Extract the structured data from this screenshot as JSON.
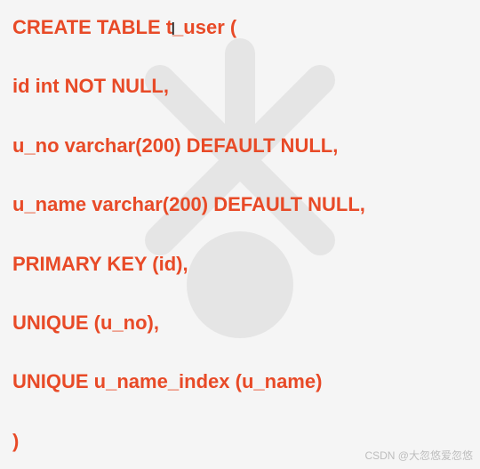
{
  "sql": {
    "lines": [
      "CREATE TABLE t_user (",
      " id int NOT NULL,",
      " u_no varchar(200) DEFAULT NULL,",
      " u_name varchar(200) DEFAULT NULL,",
      " PRIMARY KEY (id),",
      " UNIQUE (u_no),",
      " UNIQUE u_name_index (u_name)",
      ")"
    ]
  },
  "attribution": "CSDN @大忽悠爱忽悠",
  "cursor_glyph": "I"
}
